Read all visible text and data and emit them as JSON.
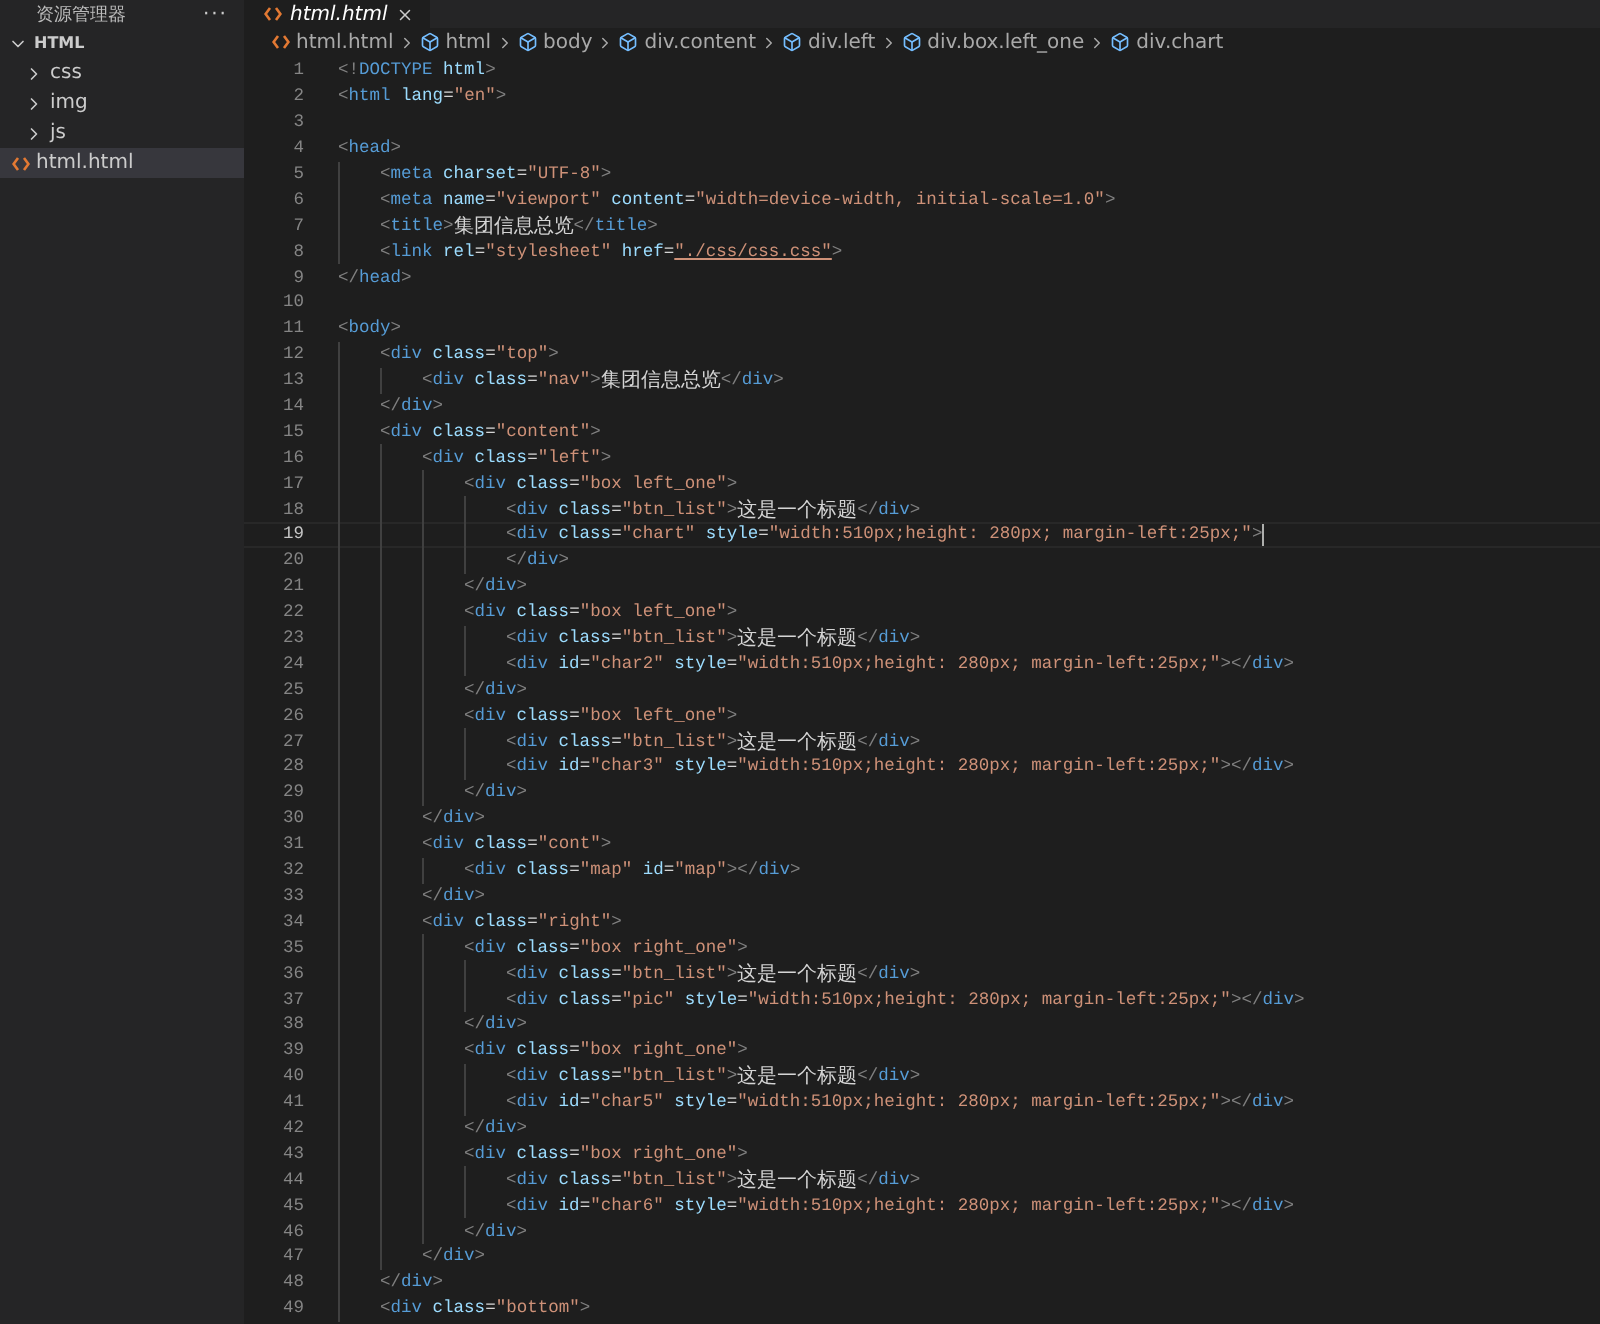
{
  "sidebar": {
    "title": "资源管理器",
    "more": "···",
    "folder": {
      "name": "HTML",
      "expanded": true,
      "children": [
        {
          "kind": "folder",
          "name": "css",
          "expanded": false,
          "selected": false
        },
        {
          "kind": "folder",
          "name": "img",
          "expanded": false,
          "selected": false
        },
        {
          "kind": "folder",
          "name": "js",
          "expanded": false,
          "selected": false
        },
        {
          "kind": "file",
          "name": "html.html",
          "selected": true
        }
      ]
    }
  },
  "tabs": [
    {
      "label": "html.html",
      "selected": true,
      "preview": true
    }
  ],
  "breadcrumb": [
    {
      "kind": "file",
      "label": "html.html"
    },
    {
      "kind": "element",
      "label": "html"
    },
    {
      "kind": "element",
      "label": "body"
    },
    {
      "kind": "element",
      "label": "div.content"
    },
    {
      "kind": "element",
      "label": "div.left"
    },
    {
      "kind": "element",
      "label": "div.box.left_one"
    },
    {
      "kind": "element",
      "label": "div.chart"
    }
  ],
  "editor": {
    "lines": [
      {
        "number": "1",
        "text": "<!DOCTYPE html>",
        "current": false
      },
      {
        "number": "2",
        "text": "<html lang=\"en\">",
        "current": false
      },
      {
        "number": "3",
        "current": false
      },
      {
        "number": "4",
        "text": "<head>",
        "current": false
      },
      {
        "number": "5",
        "text": "    <meta charset=\"UTF-8\">",
        "current": false
      },
      {
        "number": "6",
        "text": "    <meta name=\"viewport\" content=\"width=device-width, initial-scale=1.0\">",
        "current": false
      },
      {
        "number": "7",
        "text": "    <title>集团信息总览</title>",
        "current": false
      },
      {
        "number": "8",
        "text": "    <link rel=\"stylesheet\" href=\"./css/css.css\">",
        "current": false,
        "link": true
      },
      {
        "number": "9",
        "text": "</head>",
        "current": false
      },
      {
        "number": "10",
        "current": false
      },
      {
        "number": "11",
        "text": "<body>",
        "current": false
      },
      {
        "number": "12",
        "text": "    <div class=\"top\">",
        "current": false
      },
      {
        "number": "13",
        "text": "        <div class=\"nav\">集团信息总览</div>",
        "current": false
      },
      {
        "number": "14",
        "text": "    </div>",
        "current": false
      },
      {
        "number": "15",
        "text": "    <div class=\"content\">",
        "current": false
      },
      {
        "number": "16",
        "text": "        <div class=\"left\">",
        "current": false
      },
      {
        "number": "17",
        "text": "            <div class=\"box left_one\">",
        "current": false
      },
      {
        "number": "18",
        "text": "                <div class=\"btn_list\">这是一个标题</div>",
        "current": false
      },
      {
        "number": "19",
        "text": "                <div class=\"chart\" style=\"width:510px;height: 280px; margin-left:25px;\">",
        "current": true
      },
      {
        "number": "20",
        "text": "                </div>",
        "current": false
      },
      {
        "number": "21",
        "text": "            </div>",
        "current": false
      },
      {
        "number": "22",
        "text": "            <div class=\"box left_one\">",
        "current": false
      },
      {
        "number": "23",
        "text": "                <div class=\"btn_list\">这是一个标题</div>",
        "current": false
      },
      {
        "number": "24",
        "text": "                <div id=\"char2\" style=\"width:510px;height: 280px; margin-left:25px;\"></div>",
        "current": false
      },
      {
        "number": "25",
        "text": "            </div>",
        "current": false
      },
      {
        "number": "26",
        "text": "            <div class=\"box left_one\">",
        "current": false
      },
      {
        "number": "27",
        "text": "                <div class=\"btn_list\">这是一个标题</div>",
        "current": false
      },
      {
        "number": "28",
        "text": "                <div id=\"char3\" style=\"width:510px;height: 280px; margin-left:25px;\"></div>",
        "current": false
      },
      {
        "number": "29",
        "text": "            </div>",
        "current": false
      },
      {
        "number": "30",
        "text": "        </div>",
        "current": false
      },
      {
        "number": "31",
        "text": "        <div class=\"cont\">",
        "current": false
      },
      {
        "number": "32",
        "text": "            <div class=\"map\" id=\"map\"></div>",
        "current": false
      },
      {
        "number": "33",
        "text": "        </div>",
        "current": false
      },
      {
        "number": "34",
        "text": "        <div class=\"right\">",
        "current": false
      },
      {
        "number": "35",
        "text": "            <div class=\"box right_one\">",
        "current": false
      },
      {
        "number": "36",
        "text": "                <div class=\"btn_list\">这是一个标题</div>",
        "current": false
      },
      {
        "number": "37",
        "text": "                <div class=\"pic\" style=\"width:510px;height: 280px; margin-left:25px;\"></div>",
        "current": false
      },
      {
        "number": "38",
        "text": "            </div>",
        "current": false
      },
      {
        "number": "39",
        "text": "            <div class=\"box right_one\">",
        "current": false
      },
      {
        "number": "40",
        "text": "                <div class=\"btn_list\">这是一个标题</div>",
        "current": false
      },
      {
        "number": "41",
        "text": "                <div id=\"char5\" style=\"width:510px;height: 280px; margin-left:25px;\"></div>",
        "current": false
      },
      {
        "number": "42",
        "text": "            </div>",
        "current": false
      },
      {
        "number": "43",
        "text": "            <div class=\"box right_one\">",
        "current": false
      },
      {
        "number": "44",
        "text": "                <div class=\"btn_list\">这是一个标题</div>",
        "current": false
      },
      {
        "number": "45",
        "text": "                <div id=\"char6\" style=\"width:510px;height: 280px; margin-left:25px;\"></div>",
        "current": false
      },
      {
        "number": "46",
        "text": "            </div>",
        "current": false
      },
      {
        "number": "47",
        "text": "        </div>",
        "current": false
      },
      {
        "number": "48",
        "text": "    </div>",
        "current": false
      },
      {
        "number": "49",
        "text": "    <div class=\"bottom\">",
        "current": false
      }
    ]
  }
}
